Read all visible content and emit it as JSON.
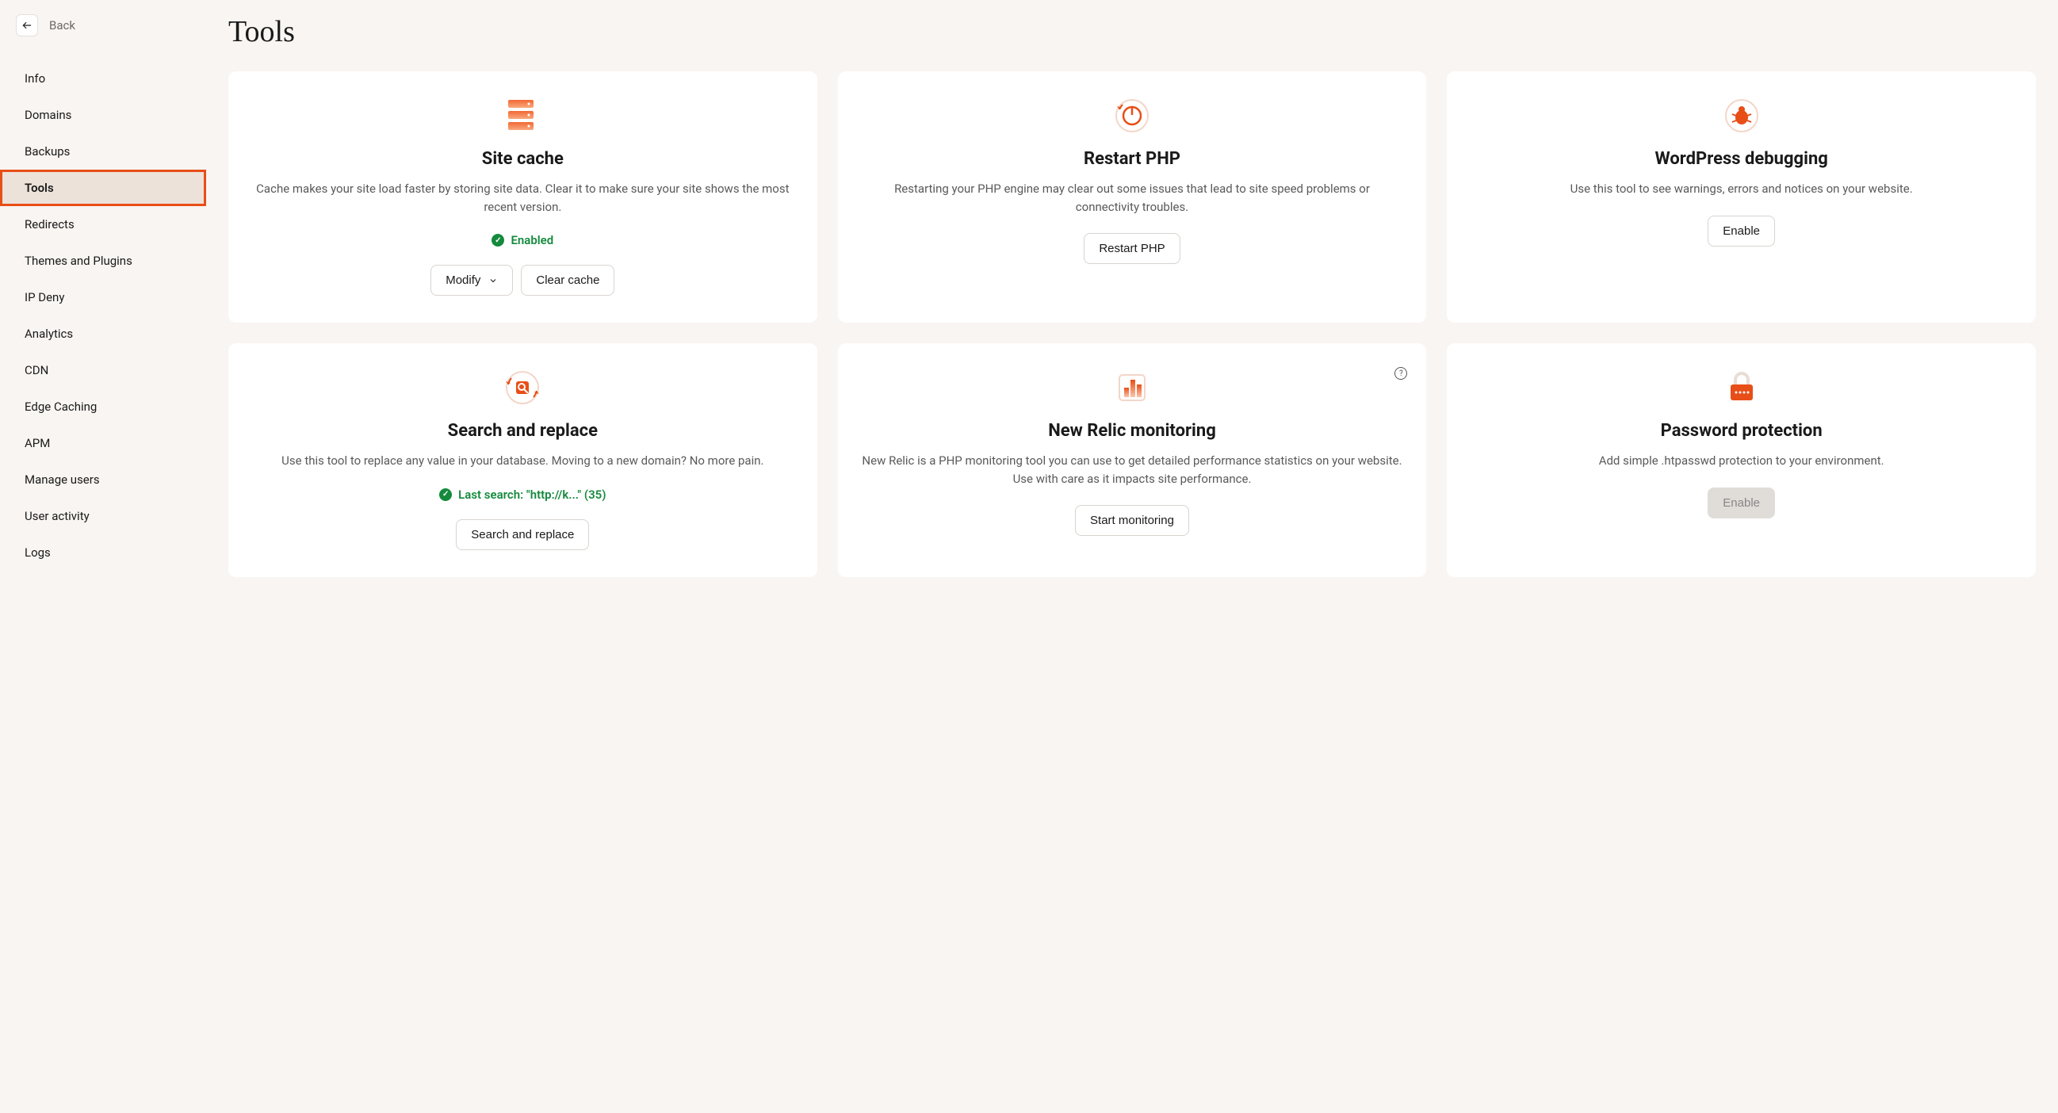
{
  "header": {
    "back_label": "Back",
    "page_title": "Tools"
  },
  "sidebar": {
    "items": [
      {
        "label": "Info",
        "active": false
      },
      {
        "label": "Domains",
        "active": false
      },
      {
        "label": "Backups",
        "active": false
      },
      {
        "label": "Tools",
        "active": true
      },
      {
        "label": "Redirects",
        "active": false
      },
      {
        "label": "Themes and Plugins",
        "active": false
      },
      {
        "label": "IP Deny",
        "active": false
      },
      {
        "label": "Analytics",
        "active": false
      },
      {
        "label": "CDN",
        "active": false
      },
      {
        "label": "Edge Caching",
        "active": false
      },
      {
        "label": "APM",
        "active": false
      },
      {
        "label": "Manage users",
        "active": false
      },
      {
        "label": "User activity",
        "active": false
      },
      {
        "label": "Logs",
        "active": false
      }
    ]
  },
  "cards": {
    "site_cache": {
      "title": "Site cache",
      "desc": "Cache makes your site load faster by storing site data. Clear it to make sure your site shows the most recent version.",
      "status": "Enabled",
      "modify_label": "Modify",
      "clear_label": "Clear cache"
    },
    "restart_php": {
      "title": "Restart PHP",
      "desc": "Restarting your PHP engine may clear out some issues that lead to site speed problems or connectivity troubles.",
      "btn_label": "Restart PHP"
    },
    "wp_debug": {
      "title": "WordPress debugging",
      "desc": "Use this tool to see warnings, errors and notices on your website.",
      "btn_label": "Enable"
    },
    "search_replace": {
      "title": "Search and replace",
      "desc": "Use this tool to replace any value in your database. Moving to a new domain? No more pain.",
      "status": "Last search: \"http://k...\" (35)",
      "btn_label": "Search and replace"
    },
    "new_relic": {
      "title": "New Relic monitoring",
      "desc": "New Relic is a PHP monitoring tool you can use to get detailed performance statistics on your website. Use with care as it impacts site performance.",
      "btn_label": "Start monitoring"
    },
    "password_protect": {
      "title": "Password protection",
      "desc": "Add simple .htpasswd protection to your environment.",
      "btn_label": "Enable"
    }
  }
}
